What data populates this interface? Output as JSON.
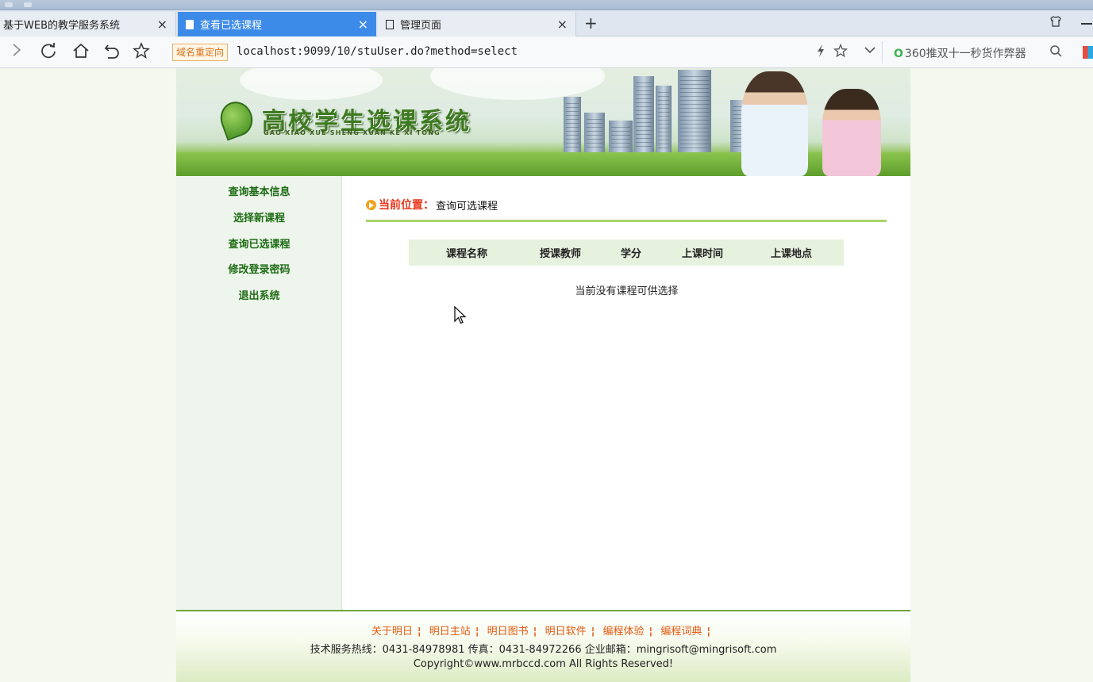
{
  "browser": {
    "tabs": [
      {
        "label": "基于WEB的教学服务系统",
        "active": false
      },
      {
        "label": "查看已选课程",
        "active": true
      },
      {
        "label": "管理页面",
        "active": false
      }
    ],
    "close_glyph": "×",
    "new_tab_glyph": "+",
    "redirect_badge": "域名重定向",
    "url": "localhost:9099/10/stuUser.do?method=select",
    "search_placeholder": "360推双十一秒货作弊器",
    "search_brand_glyph": "O",
    "accent_color": "#3d8be8"
  },
  "banner": {
    "title": "高校学生选课系统",
    "subtitle": "GAO XIAO XUE SHENG XUAN KE XI TONG"
  },
  "sidebar": {
    "items": [
      {
        "label": "查询基本信息"
      },
      {
        "label": "选择新课程"
      },
      {
        "label": "查询已选课程"
      },
      {
        "label": "修改登录密码"
      },
      {
        "label": "退出系统"
      }
    ]
  },
  "content": {
    "location_label": "当前位置：",
    "location_value": "查询可选课程",
    "table_headers": [
      "课程名称",
      "授课教师",
      "学分",
      "上课时间",
      "上课地点"
    ],
    "empty_message": "当前没有课程可供选择"
  },
  "footer": {
    "links": [
      "关于明日",
      "明日主站",
      "明日图书",
      "明日软件",
      "编程体验",
      "编程词典"
    ],
    "separator": "¦",
    "hotline": "技术服务热线：0431-84978981 传真：0431-84972266 企业邮箱：mingrisoft@mingrisoft.com",
    "copyright": "Copyright©www.mrbccd.com All Rights Reserved!"
  }
}
